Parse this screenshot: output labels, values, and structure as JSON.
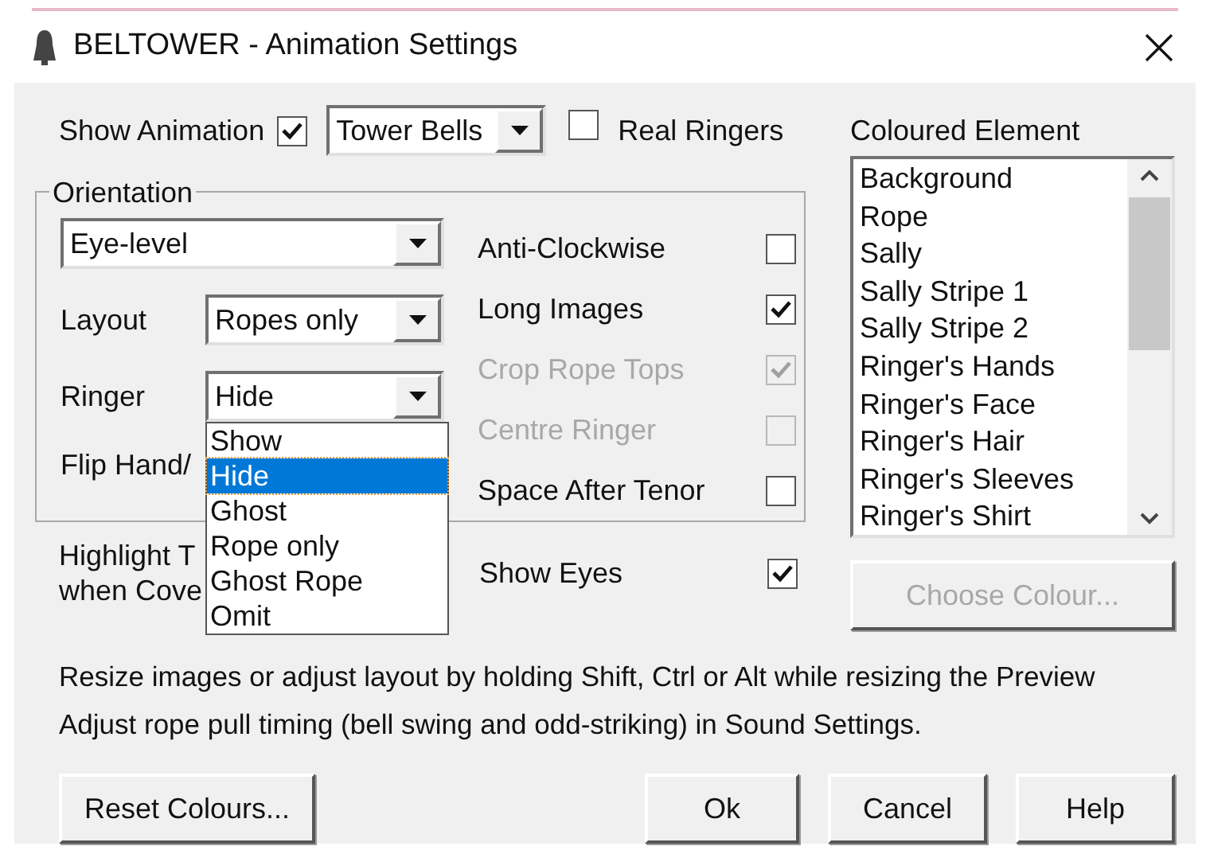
{
  "window": {
    "title": "BELTOWER - Animation Settings"
  },
  "show_animation": {
    "label": "Show Animation",
    "checked": true
  },
  "animation_type": {
    "value": "Tower Bells"
  },
  "real_ringers": {
    "label": "Real Ringers",
    "checked": false
  },
  "orientation": {
    "title": "Orientation",
    "view": {
      "value": "Eye-level"
    },
    "layout": {
      "label": "Layout",
      "value": "Ropes only"
    },
    "ringer": {
      "label": "Ringer",
      "value": "Hide",
      "expanded": true,
      "options": [
        {
          "label": "Show",
          "selected": false
        },
        {
          "label": "Hide",
          "selected": true
        },
        {
          "label": "Ghost",
          "selected": false
        },
        {
          "label": "Rope only",
          "selected": false
        },
        {
          "label": "Ghost Rope",
          "selected": false
        },
        {
          "label": "Omit",
          "selected": false
        }
      ]
    },
    "flip_label": "Flip Hand/",
    "options": [
      {
        "label": "Anti-Clockwise",
        "checked": false,
        "disabled": false
      },
      {
        "label": "Long Images",
        "checked": true,
        "disabled": false
      },
      {
        "label": "Crop Rope Tops",
        "checked": true,
        "disabled": true
      },
      {
        "label": "Centre Ringer",
        "checked": false,
        "disabled": true
      },
      {
        "label": "Space After Tenor",
        "checked": false,
        "disabled": false
      }
    ]
  },
  "highlight_lines": [
    "Highlight T",
    "when Cove"
  ],
  "show_eyes": {
    "label": "Show Eyes",
    "checked": true
  },
  "coloured_element": {
    "label": "Coloured Element",
    "items": [
      "Background",
      "Rope",
      "Sally",
      "Sally Stripe 1",
      "Sally Stripe 2",
      "Ringer's Hands",
      "Ringer's Face",
      "Ringer's Hair",
      "Ringer's Sleeves",
      "Ringer's Shirt"
    ]
  },
  "choose_colour": {
    "label": "Choose Colour...",
    "disabled": true
  },
  "notes": [
    "Resize images or adjust layout by holding Shift, Ctrl or Alt while resizing the Preview",
    "Adjust rope pull timing (bell swing and odd-striking) in Sound Settings."
  ],
  "reset_button": {
    "label": "Reset Colours..."
  },
  "buttons": [
    {
      "label": "Ok"
    },
    {
      "label": "Cancel"
    },
    {
      "label": "Help"
    }
  ]
}
